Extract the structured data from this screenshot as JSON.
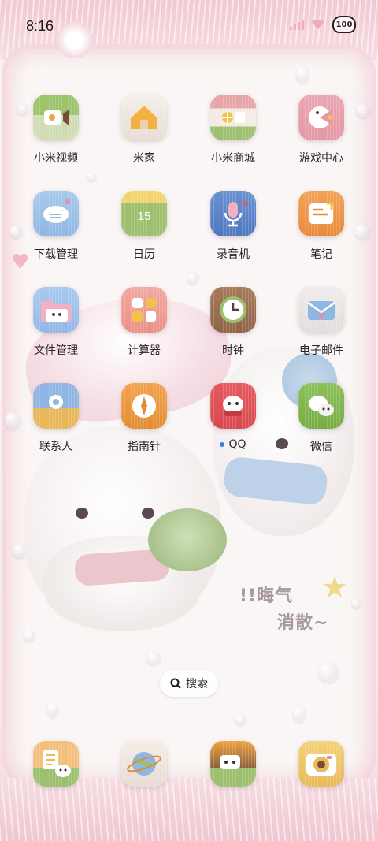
{
  "status_bar": {
    "time": "8:16",
    "battery": "100",
    "icons": [
      "signal-icon",
      "wifi-icon",
      "battery-icon"
    ]
  },
  "apps": [
    {
      "label": "小米视频",
      "icon": "video-icon"
    },
    {
      "label": "米家",
      "icon": "home-icon"
    },
    {
      "label": "小米商城",
      "icon": "store-icon"
    },
    {
      "label": "游戏中心",
      "icon": "game-icon"
    },
    {
      "label": "下载管理",
      "icon": "download-icon"
    },
    {
      "label": "日历",
      "icon": "calendar-icon",
      "badge": "15"
    },
    {
      "label": "录音机",
      "icon": "microphone-icon"
    },
    {
      "label": "笔记",
      "icon": "notes-icon"
    },
    {
      "label": "文件管理",
      "icon": "folder-icon"
    },
    {
      "label": "计算器",
      "icon": "calculator-icon"
    },
    {
      "label": "时钟",
      "icon": "clock-icon"
    },
    {
      "label": "电子邮件",
      "icon": "mail-icon"
    },
    {
      "label": "联系人",
      "icon": "contacts-icon"
    },
    {
      "label": "指南针",
      "icon": "compass-icon"
    },
    {
      "label": "QQ",
      "icon": "qq-icon",
      "new_indicator": true
    },
    {
      "label": "微信",
      "icon": "wechat-icon"
    }
  ],
  "search": {
    "label": "搜索"
  },
  "dock": [
    {
      "icon": "phone-icon"
    },
    {
      "icon": "browser-icon"
    },
    {
      "icon": "messages-icon"
    },
    {
      "icon": "camera-icon"
    }
  ],
  "wallpaper": {
    "text_line1": "!!晦气",
    "text_line2": "消散~"
  },
  "colors": {
    "accent_pink": "#f0aab8",
    "notification_dot": "#3b7cf0"
  }
}
